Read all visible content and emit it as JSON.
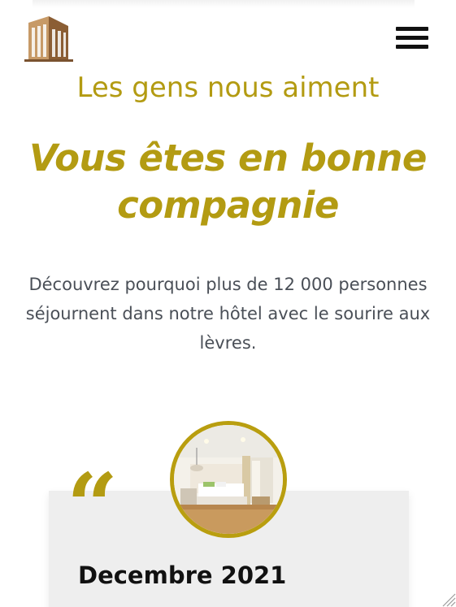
{
  "header": {
    "logo_icon": "building-icon",
    "menu_icon": "hamburger-menu-icon"
  },
  "testimonials": {
    "eyebrow": "Les gens nous aiment",
    "headline": "Vous êtes en bonne compagnie",
    "intro": "Découvrez pourquoi plus de 12 000 personnes séjournent dans notre hôtel avec le sourire aux lèvres.",
    "accent_color": "#b39b12",
    "card": {
      "quote_mark": "“",
      "image": "hotel-room-photo",
      "date": "Decembre 2021"
    }
  }
}
